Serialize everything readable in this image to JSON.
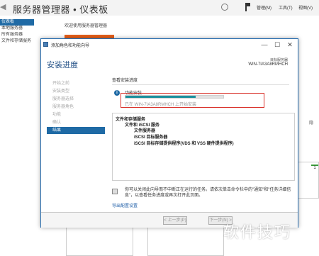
{
  "server_manager": {
    "back_glyph": "◀",
    "title": "服务器管理器 • 仪表板",
    "menus": [
      "管理(M)",
      "工具(T)",
      "视图(V)"
    ],
    "nav_items": [
      "仪表板",
      "本地服务器",
      "所有服务器",
      "文件和存储服务"
    ],
    "welcome": "欢迎使用服务器管理器",
    "tab_partial": "隐",
    "badge": "1"
  },
  "wizard": {
    "title": "添加角色和功能向导",
    "window_buttons": {
      "minimize": "—",
      "maximize": "☐",
      "close": "✕"
    },
    "heading": "安装进度",
    "target_label": "目标服务器",
    "target_value": "WIN-7IA3A8RMHCH",
    "steps": [
      "开始之前",
      "安装类型",
      "服务器选择",
      "服务器角色",
      "功能",
      "确认",
      "结果"
    ],
    "active_step": 6,
    "view_title": "查看安装进度",
    "feature_label": "功能安装",
    "progress": 0.72,
    "status": "已在 WIN-7IA3A8RMHCH 上开始安装",
    "results": [
      "文件和存储服务",
      "文件和 iSCSI 服务",
      "文件服务器",
      "iSCSI 目标服务器",
      "iSCSI 目标存储提供程序(VDS 和 VSS 硬件提供程序)"
    ],
    "note": "你可以关闭此向导而不中断正在运行的任务。请依次单击命令栏中的\"通知\"和\"任务详细信息\"，以查看任务进度或再次打开此页面。",
    "export_link": "导出配置设置",
    "buttons": {
      "previous": "< 上一步(P)",
      "next": "下一步(N) >"
    }
  },
  "watermark": "软件技巧",
  "colors": {
    "accent": "#1f6aa5",
    "progress": "#1c8f9c",
    "highlight": "#d9322b",
    "orange_tile": "#e55f1b"
  }
}
